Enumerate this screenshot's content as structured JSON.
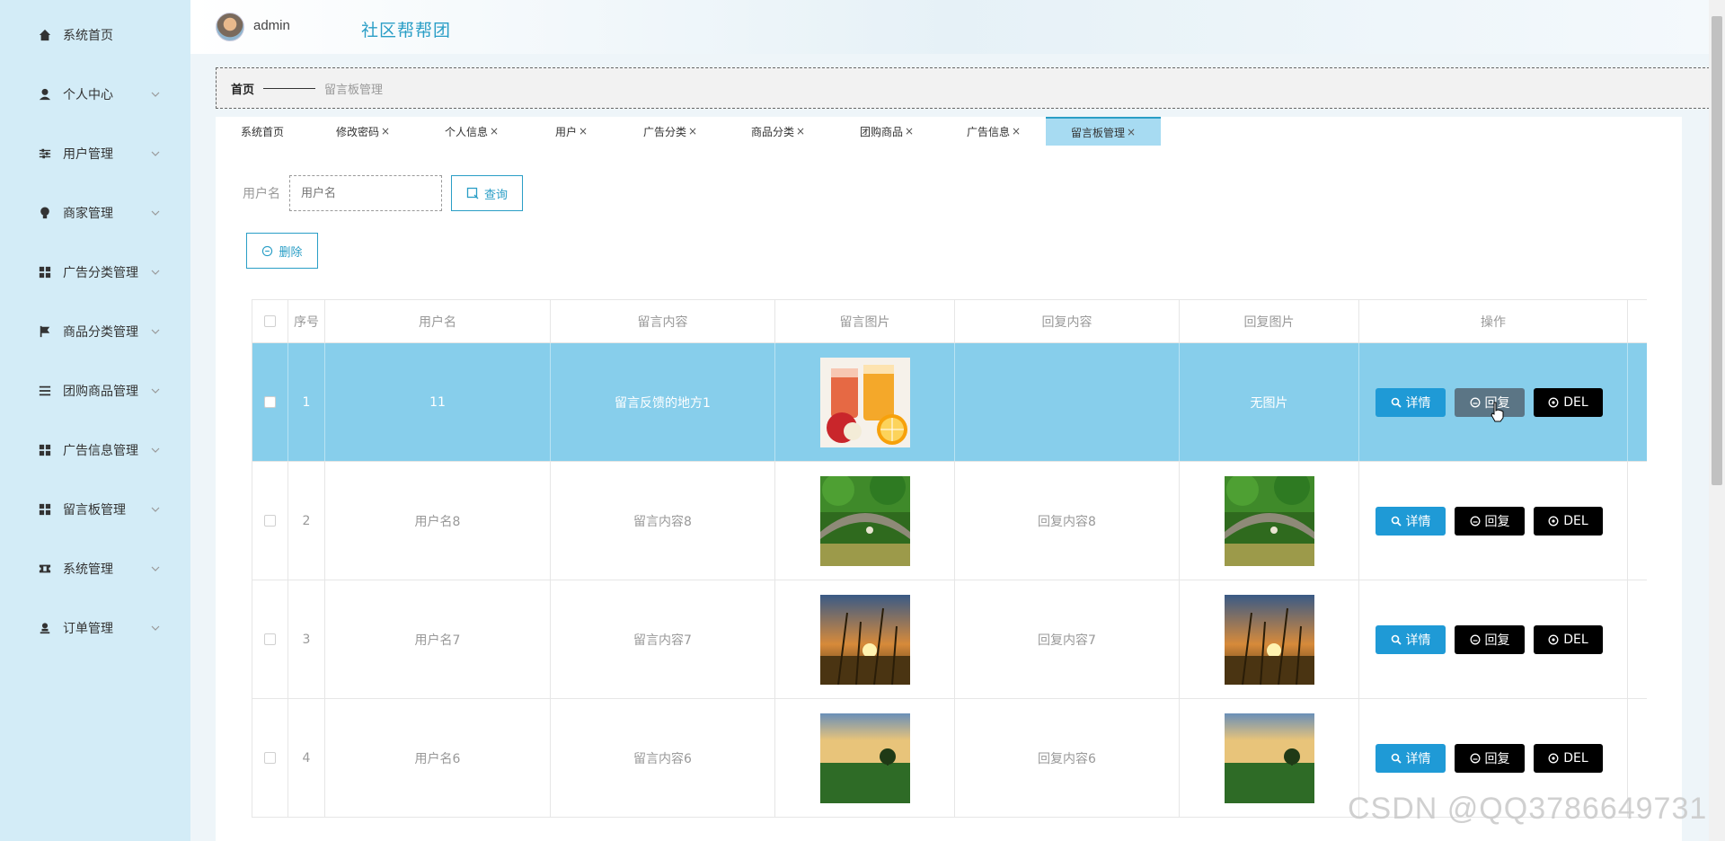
{
  "sidebar": {
    "items": [
      {
        "label": "系统首页",
        "icon": "home-icon",
        "chevron": false
      },
      {
        "label": "个人中心",
        "icon": "user-icon",
        "chevron": true
      },
      {
        "label": "用户管理",
        "icon": "sliders-icon",
        "chevron": true
      },
      {
        "label": "商家管理",
        "icon": "bulb-icon",
        "chevron": true
      },
      {
        "label": "广告分类管理",
        "icon": "grid-icon",
        "chevron": true
      },
      {
        "label": "商品分类管理",
        "icon": "flag-icon",
        "chevron": true
      },
      {
        "label": "团购商品管理",
        "icon": "list-icon",
        "chevron": true
      },
      {
        "label": "广告信息管理",
        "icon": "grid-icon",
        "chevron": true
      },
      {
        "label": "留言板管理",
        "icon": "grid-icon",
        "chevron": true
      },
      {
        "label": "系统管理",
        "icon": "ticket-icon",
        "chevron": true
      },
      {
        "label": "订单管理",
        "icon": "person-stamp-icon",
        "chevron": true
      }
    ]
  },
  "header": {
    "username": "admin",
    "app_title": "社区帮帮团"
  },
  "breadcrumb": {
    "home": "首页",
    "current": "留言板管理"
  },
  "tabs": [
    {
      "label": "系统首页",
      "closable": false,
      "active": false
    },
    {
      "label": "修改密码",
      "closable": true,
      "active": false
    },
    {
      "label": "个人信息",
      "closable": true,
      "active": false
    },
    {
      "label": "用户",
      "closable": true,
      "active": false
    },
    {
      "label": "广告分类",
      "closable": true,
      "active": false
    },
    {
      "label": "商品分类",
      "closable": true,
      "active": false
    },
    {
      "label": "团购商品",
      "closable": true,
      "active": false
    },
    {
      "label": "广告信息",
      "closable": true,
      "active": false
    },
    {
      "label": "留言板管理",
      "closable": true,
      "active": true
    }
  ],
  "tab_close_glyph": "×",
  "search": {
    "label": "用户名",
    "placeholder": "用户名",
    "query_button": "查询"
  },
  "toolbar": {
    "delete_button": "删除"
  },
  "table": {
    "columns": [
      "序号",
      "用户名",
      "留言内容",
      "留言图片",
      "回复内容",
      "回复图片",
      "操作"
    ],
    "rows": [
      {
        "index": "1",
        "username": "11",
        "content": "留言反馈的地方1",
        "image": "juice",
        "reply": "",
        "reply_image": "",
        "reply_image_text": "无图片",
        "highlighted": true
      },
      {
        "index": "2",
        "username": "用户名8",
        "content": "留言内容8",
        "image": "bridge",
        "reply": "回复内容8",
        "reply_image": "bridge",
        "reply_image_text": "",
        "highlighted": false
      },
      {
        "index": "3",
        "username": "用户名7",
        "content": "留言内容7",
        "image": "sunset",
        "reply": "回复内容7",
        "reply_image": "sunset",
        "reply_image_text": "",
        "highlighted": false
      },
      {
        "index": "4",
        "username": "用户名6",
        "content": "留言内容6",
        "image": "field",
        "reply": "回复内容6",
        "reply_image": "field",
        "reply_image_text": "",
        "highlighted": false
      }
    ],
    "actions": {
      "detail": "详情",
      "reply": "回复",
      "delete": "DEL"
    }
  },
  "colors": {
    "accent": "#2a9ec6",
    "sidebar_bg": "#d3ecf7",
    "highlight_row": "#87ceeb",
    "detail_button": "#1f9ad6"
  },
  "watermark": "CSDN @QQ3786649731"
}
